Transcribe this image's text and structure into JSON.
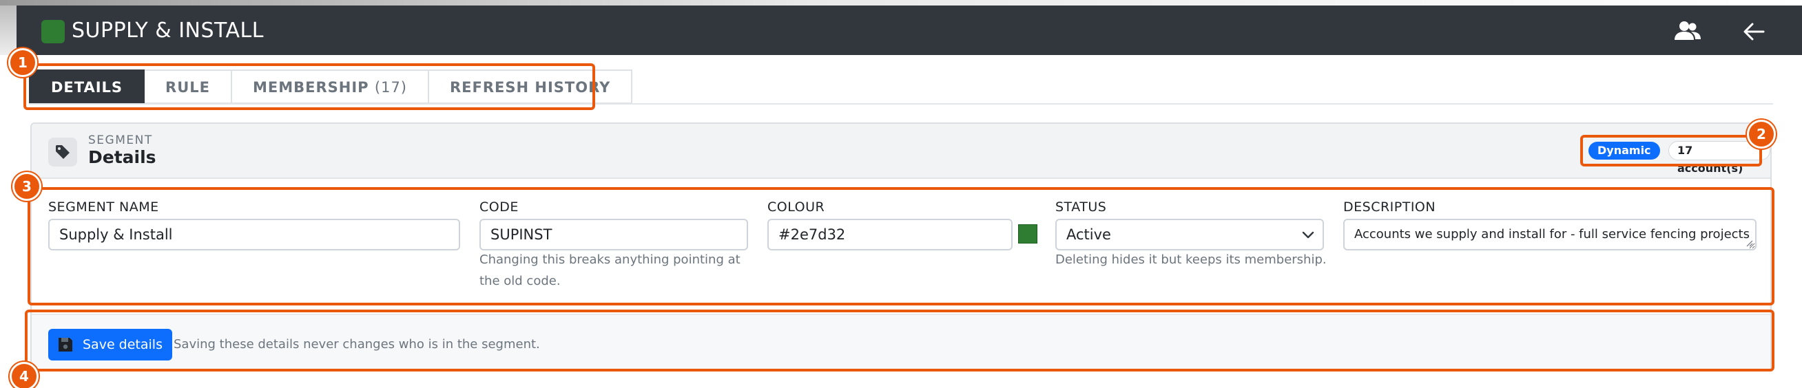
{
  "app": {
    "title": "SUPPLY & INSTALL",
    "brand_color": "#2e7d32"
  },
  "topbar": {
    "icons": [
      "users-icon",
      "arrow-left-icon"
    ]
  },
  "tabs": [
    {
      "label": "DETAILS",
      "count": "",
      "active": true
    },
    {
      "label": "RULE",
      "count": "",
      "active": false
    },
    {
      "label": "MEMBERSHIP",
      "count": "(17)",
      "active": false
    },
    {
      "label": "REFRESH HISTORY",
      "count": "",
      "active": false
    }
  ],
  "card": {
    "kicker": "SEGMENT",
    "title": "Details",
    "icon": "tag-icon",
    "badges": {
      "type": "Dynamic",
      "accounts": "17 account(s)"
    }
  },
  "form": {
    "segment_name": {
      "label": "SEGMENT NAME",
      "value": "Supply & Install"
    },
    "code": {
      "label": "CODE",
      "value": "SUPINST",
      "help_line1": "Changing this breaks anything pointing at",
      "help_line2": "the old code."
    },
    "colour": {
      "label": "COLOUR",
      "value": "#2e7d32"
    },
    "status": {
      "label": "STATUS",
      "value": "Active",
      "help": "Deleting hides it but keeps its membership."
    },
    "description": {
      "label": "DESCRIPTION",
      "value": "Accounts we supply and install for - full service fencing projects"
    }
  },
  "footer": {
    "save_label": "Save details",
    "note": "Saving these details never changes who is in the segment."
  },
  "annotations": [
    "1",
    "2",
    "3",
    "4"
  ],
  "colors": {
    "topbar": "#32373e",
    "primary": "#0d6efd",
    "annotation": "#ea580c"
  }
}
